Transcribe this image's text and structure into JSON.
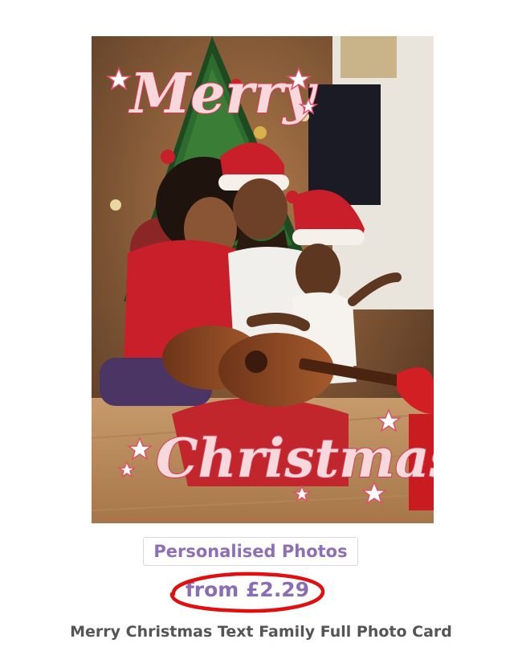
{
  "product": {
    "image_alt": "Merry Christmas Text Family Full Photo Card",
    "image_overlay_top": "Merry",
    "image_overlay_bottom": "Christmas",
    "category_tag": "Personalised Photos",
    "price": "from £2.29",
    "title": "Merry Christmas Text Family Full Photo Card"
  },
  "colors": {
    "accent_purple": "#8e6fb6",
    "highlight_ring": "#e01010",
    "title_text": "#555555"
  }
}
